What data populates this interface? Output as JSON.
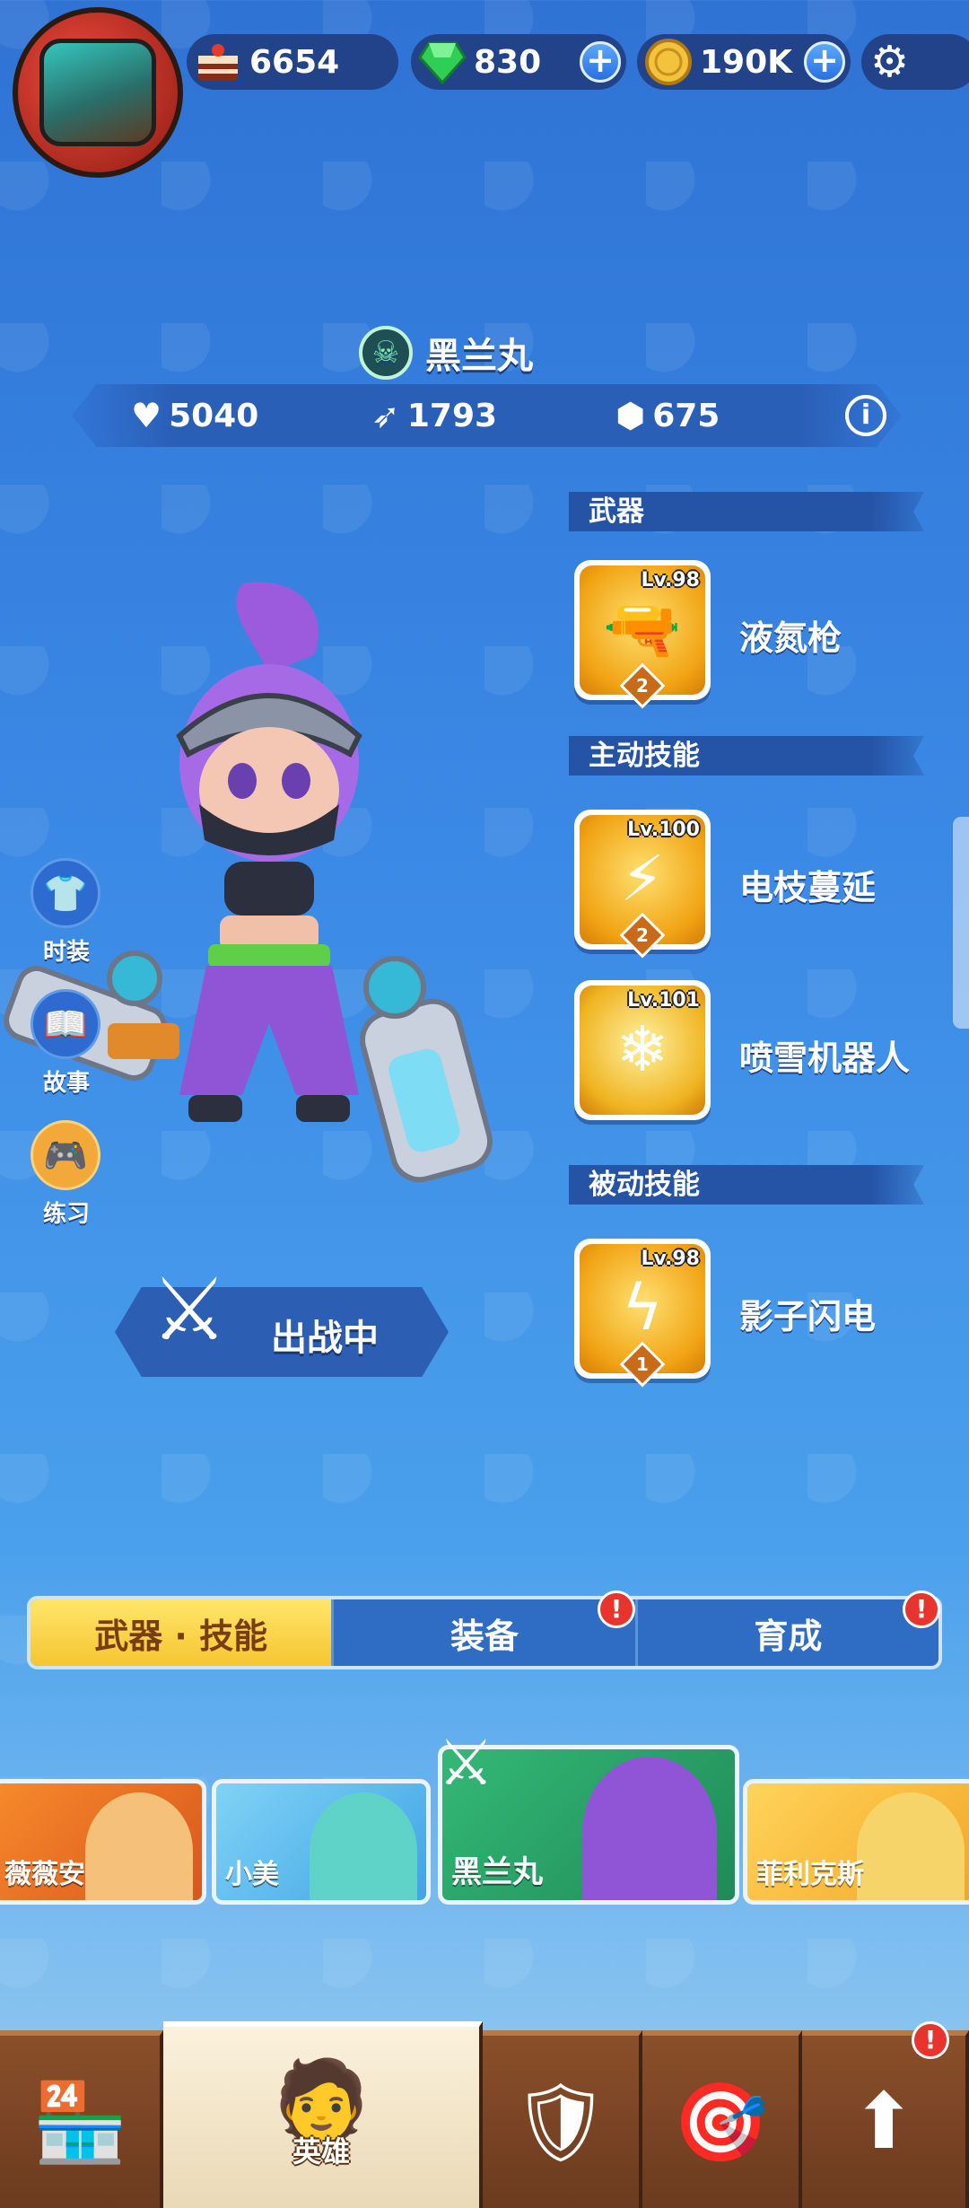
{
  "currencies": {
    "cake": "6654",
    "gems": "830",
    "coins": "190K"
  },
  "hero": {
    "name": "黑兰丸",
    "hp": "5040",
    "attack": "1793",
    "defense": "675",
    "deploy_label": "出战中"
  },
  "sections": {
    "weapon": "武器",
    "active": "主动技能",
    "passive": "被动技能"
  },
  "skills": [
    {
      "level": "Lv.98",
      "name": "液氮枪",
      "stars": "2",
      "icon": "ice-gun-icon"
    },
    {
      "level": "Lv.100",
      "name": "电枝蔓延",
      "stars": "2",
      "icon": "lightning-burst-icon"
    },
    {
      "level": "Lv.101",
      "name": "喷雪机器人",
      "stars": "",
      "icon": "snow-robot-icon"
    },
    {
      "level": "Lv.98",
      "name": "影子闪电",
      "stars": "1",
      "icon": "shadow-lightning-icon"
    }
  ],
  "side_buttons": [
    "时装",
    "故事",
    "练习"
  ],
  "tabs": [
    "武器 · 技能",
    "装备",
    "育成"
  ],
  "hero_list": [
    "薇薇安",
    "小美",
    "黑兰丸",
    "菲利克斯"
  ],
  "nav": {
    "heroes_label": "英雄"
  },
  "colors": {
    "background_top": "#2f73d4",
    "active_tab": "#f6c531",
    "alert": "#e8342c",
    "selected_hero_card": "#2ea36a"
  }
}
